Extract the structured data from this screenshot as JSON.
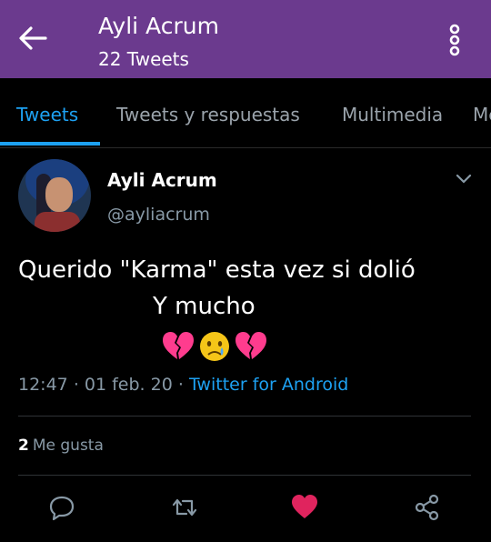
{
  "header": {
    "title": "Ayli Acrum",
    "subtitle": "22 Tweets"
  },
  "tabs": [
    {
      "label": "Tweets",
      "active": true
    },
    {
      "label": "Tweets y respuestas",
      "active": false
    },
    {
      "label": "Multimedia",
      "active": false
    },
    {
      "label": "Me",
      "active": false
    }
  ],
  "tweet": {
    "author_name": "Ayli Acrum",
    "author_handle": "@ayliacrum",
    "text_line1": "Querido \"Karma\" esta vez si dolió",
    "text_line2": "Y mucho",
    "emojis": [
      "broken-heart",
      "crying-face",
      "broken-heart"
    ],
    "time": "12:47",
    "date": "01 feb. 20",
    "via": "Twitter for Android",
    "likes_count": "2",
    "likes_label": "Me gusta"
  },
  "colors": {
    "appbar": "#6b3a8e",
    "accent": "#1da1f2",
    "muted": "#8899a6",
    "like": "#e0245e"
  }
}
